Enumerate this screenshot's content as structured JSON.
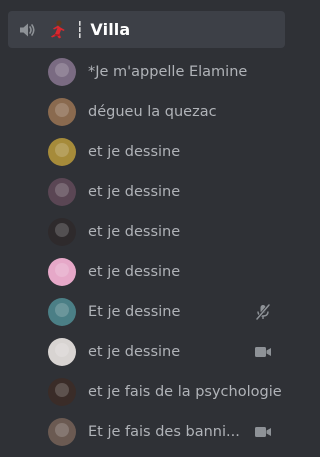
{
  "channel": {
    "speaker_icon": "speaker-icon",
    "emoji_icon": "dancer-emoji-icon",
    "name": "┆ Villa"
  },
  "users": [
    {
      "name": "*Je m'appelle Elamine",
      "avatar_color": "#7a6b82"
    },
    {
      "name": "dégueu la quezac",
      "avatar_color": "#8a6a4f"
    },
    {
      "name": "et je dessine",
      "avatar_color": "#a68b3a"
    },
    {
      "name": "et je dessine",
      "avatar_color": "#5a4654"
    },
    {
      "name": "et je dessine",
      "avatar_color": "#2e2a2c"
    },
    {
      "name": "et je dessine",
      "avatar_color": "#e6a8c8"
    },
    {
      "name": "Et je dessine",
      "avatar_color": "#4b7f86",
      "status_icon": "muted-microphone-icon"
    },
    {
      "name": "et je dessine",
      "avatar_color": "#d8d4d2",
      "status_icon": "video-camera-icon"
    },
    {
      "name": "et je fais de la psychologie",
      "avatar_color": "#3a2c28"
    },
    {
      "name": "Et je fais des banni...",
      "avatar_color": "#6b5a52",
      "status_icon": "video-camera-icon"
    }
  ],
  "colors": {
    "background": "#2f3136",
    "channel_highlight": "#3d4047",
    "channel_text": "#ffffff",
    "user_text": "#b0b3b8",
    "icon_gray": "#8e9297"
  }
}
